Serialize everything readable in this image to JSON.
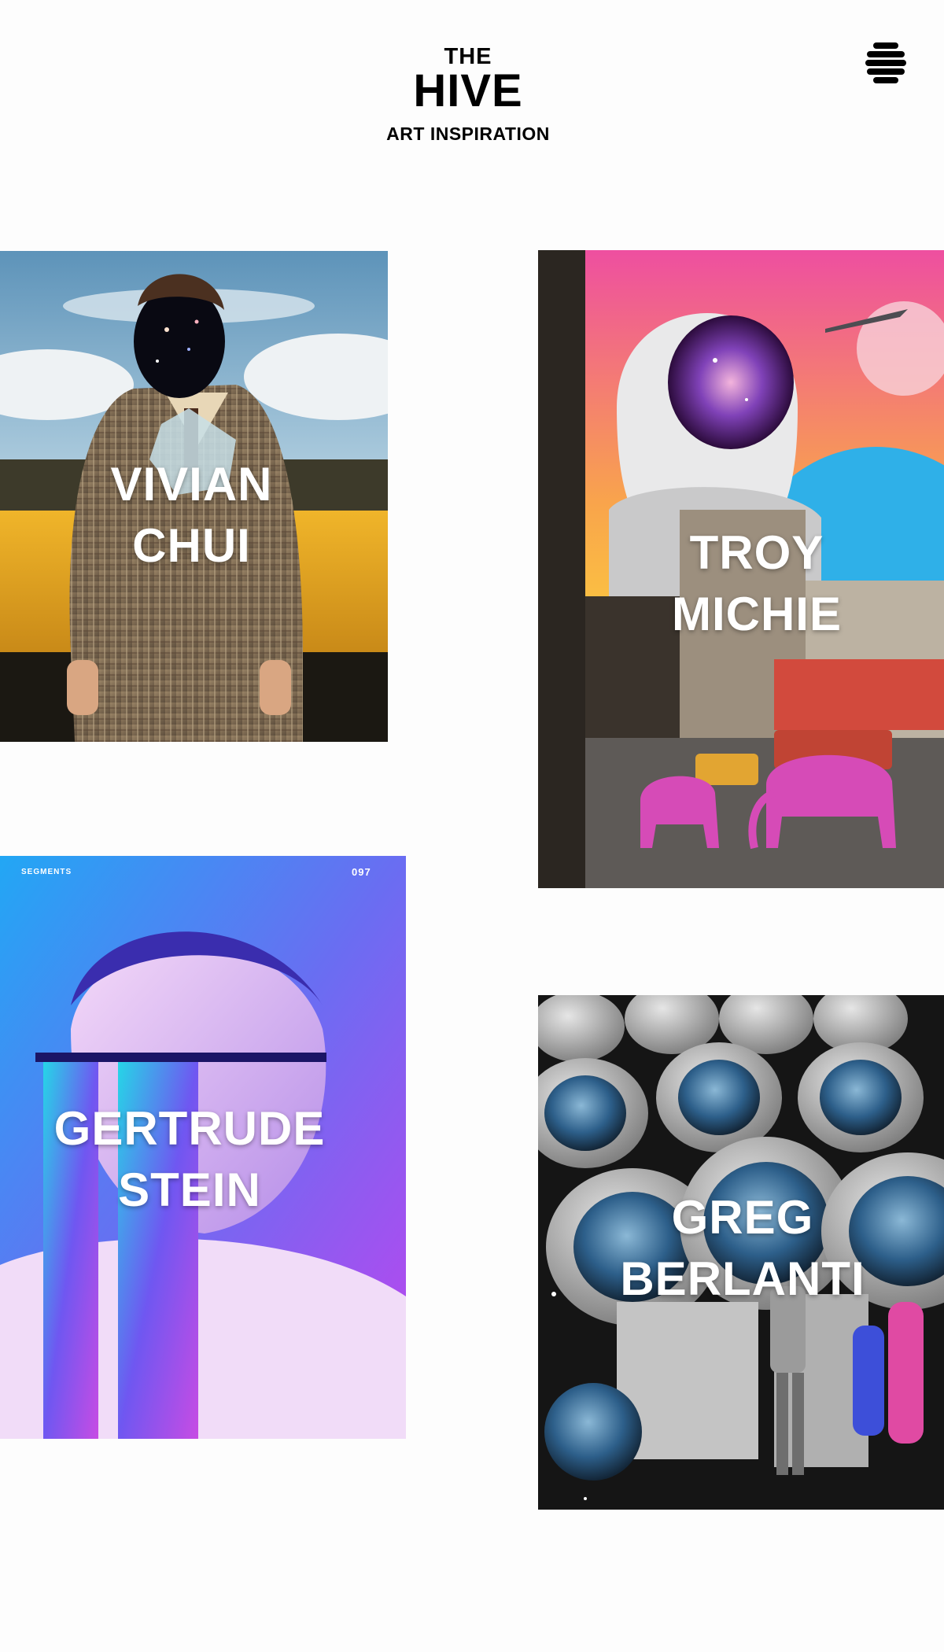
{
  "header": {
    "logo_the": "THE",
    "logo_hive": "HIVE",
    "tagline": "ART INSPIRATION",
    "menu_icon": "hamburger-icon"
  },
  "cards": [
    {
      "name_line1": "VIVIAN",
      "name_line2": "CHUI"
    },
    {
      "name_line1": "TROY",
      "name_line2": "MICHIE"
    },
    {
      "name_line1": "GERTRUDE",
      "name_line2": "STEIN",
      "poster_brand": "SEGMENTS",
      "poster_number": "097"
    },
    {
      "name_line1": "GREG",
      "name_line2": "BERLANTI"
    }
  ],
  "colors": {
    "background": "#fdfdfd",
    "text": "#000000",
    "card_text": "#ffffff"
  }
}
